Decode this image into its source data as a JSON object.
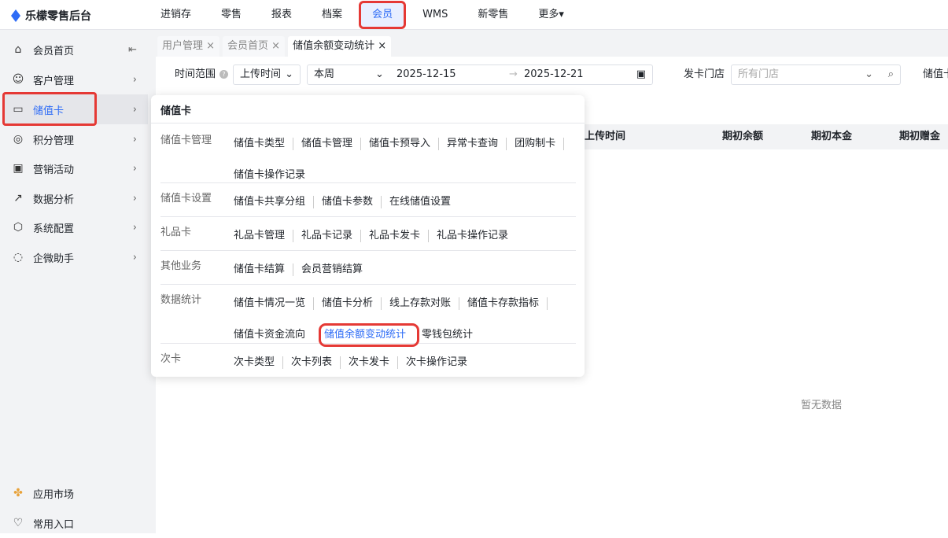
{
  "app": {
    "title": "乐檬零售后台"
  },
  "nav": [
    "进销存",
    "零售",
    "报表",
    "档案",
    "会员",
    "WMS",
    "新零售",
    "更多▾"
  ],
  "sidebar": {
    "items": [
      {
        "label": "会员首页",
        "icon": "home-icon"
      },
      {
        "label": "客户管理",
        "icon": "user-icon"
      },
      {
        "label": "储值卡",
        "icon": "card-icon"
      },
      {
        "label": "积分管理",
        "icon": "coins-icon"
      },
      {
        "label": "营销活动",
        "icon": "campaign-icon"
      },
      {
        "label": "数据分析",
        "icon": "chart-icon"
      },
      {
        "label": "系统配置",
        "icon": "settings-icon"
      },
      {
        "label": "企微助手",
        "icon": "chat-icon"
      }
    ],
    "bottom": [
      {
        "label": "应用市场"
      },
      {
        "label": "常用入口"
      }
    ]
  },
  "tabs": [
    {
      "label": "用户管理 ×"
    },
    {
      "label": "会员首页 ×"
    },
    {
      "label": "储值余额变动统计 ×"
    }
  ],
  "filter": {
    "range_label": "时间范围",
    "time_type": "上传时间",
    "period": "本周",
    "start": "2025-12-15",
    "end": "2025-12-21",
    "store_label": "发卡门店",
    "store_placeholder": "所有门店",
    "more_label": "储值卡"
  },
  "table": {
    "columns": [
      "上传时间",
      "期初余额",
      "期初本金",
      "期初赠金"
    ],
    "empty": "暂无数据"
  },
  "popup": {
    "title": "储值卡",
    "groups": [
      {
        "label": "储值卡管理",
        "items": [
          "储值卡类型",
          "储值卡管理",
          "储值卡预导入",
          "异常卡查询",
          "团购制卡",
          "储值卡操作记录"
        ]
      },
      {
        "label": "储值卡设置",
        "items": [
          "储值卡共享分组",
          "储值卡参数",
          "在线储值设置"
        ]
      },
      {
        "label": "礼品卡",
        "items": [
          "礼品卡管理",
          "礼品卡记录",
          "礼品卡发卡",
          "礼品卡操作记录"
        ]
      },
      {
        "label": "其他业务",
        "items": [
          "储值卡结算",
          "会员营销结算"
        ]
      },
      {
        "label": "数据统计",
        "items": [
          "储值卡情况一览",
          "储值卡分析",
          "线上存款对账",
          "储值卡存款指标",
          "储值卡资金流向",
          "储值余额变动统计",
          "零钱包统计"
        ]
      },
      {
        "label": "次卡",
        "items": [
          "次卡类型",
          "次卡列表",
          "次卡发卡",
          "次卡操作记录"
        ]
      }
    ]
  }
}
